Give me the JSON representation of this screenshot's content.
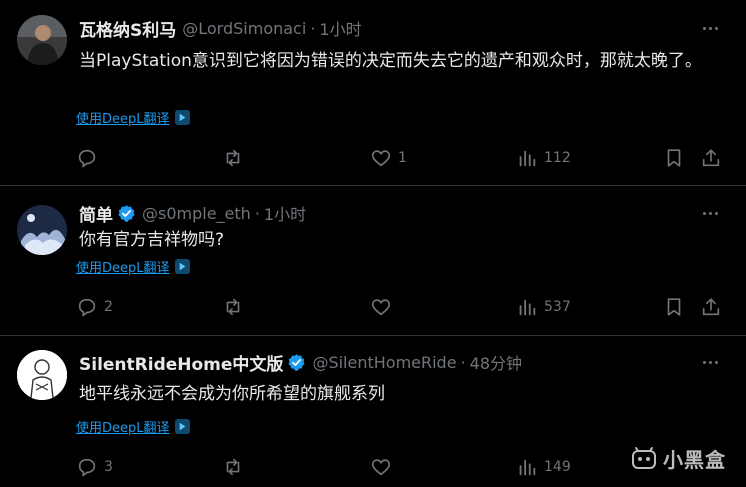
{
  "tweets": [
    {
      "name": "瓦格纳S利马",
      "verified": false,
      "handle": "@LordSimonaci",
      "dot": "·",
      "time": "1小时",
      "text": "当PlayStation意识到它将因为错误的决定而失去它的遗产和观众时，那就太晚了。",
      "translate": "使用DeepL翻译",
      "replies": "",
      "retweets": "",
      "likes": "1",
      "views": "112"
    },
    {
      "name": "简单",
      "verified": true,
      "handle": "@s0mple_eth",
      "dot": "·",
      "time": "1小时",
      "text": "你有官方吉祥物吗?",
      "translate": "使用DeepL翻译",
      "replies": "2",
      "retweets": "",
      "likes": "",
      "views": "537"
    },
    {
      "name": "SilentRideHome中文版",
      "verified": true,
      "handle": "@SilentHomeRide",
      "dot": "·",
      "time": "48分钟",
      "text": "地平线永远不会成为你所希望的旗舰系列",
      "translate": "使用DeepL翻译",
      "replies": "3",
      "retweets": "",
      "likes": "",
      "views": "149"
    }
  ],
  "watermark": "小黑盒",
  "colors": {
    "background": "#000000",
    "text": "#e7e9ea",
    "muted": "#71767b",
    "link": "#1d9bf0",
    "verified": "#1d9bf0",
    "divider": "#2f3336"
  },
  "icons": [
    "more-icon",
    "reply-icon",
    "retweet-icon",
    "like-icon",
    "views-icon",
    "bookmark-icon",
    "share-icon",
    "verified-badge-icon",
    "translate-icon"
  ]
}
